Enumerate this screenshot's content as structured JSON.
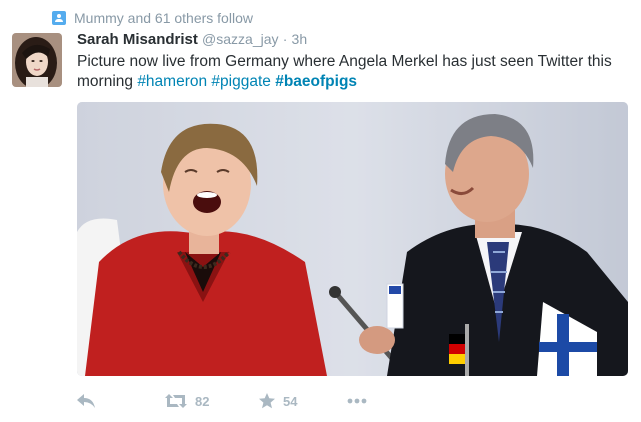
{
  "context": {
    "text": "Mummy and 61 others follow",
    "icon": "follow-user-icon"
  },
  "tweet": {
    "author_name": "Sarah Misandrist",
    "handle": "@sazza_jay",
    "separator": "·",
    "time": "3h",
    "text_plain": "Picture now live from Germany where Angela Merkel has just seen Twitter this morning",
    "hashtags": [
      "#hameron",
      "#piggate",
      "#baeofpigs"
    ]
  },
  "actions": {
    "retweet_count": "82",
    "favorite_count": "54",
    "icons": [
      "reply-icon",
      "retweet-icon",
      "favorite-star-icon",
      "more-icon"
    ]
  },
  "colors": {
    "link": "#0084b4",
    "meta_gray": "#8899a6",
    "action_gray": "#aab8c2",
    "context_icon": "#55acee"
  }
}
